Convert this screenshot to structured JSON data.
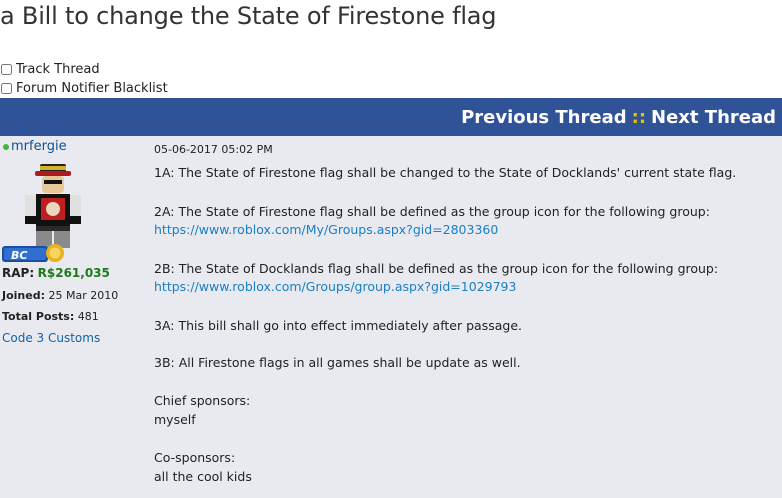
{
  "thread": {
    "title": "a Bill to change the State of Firestone flag"
  },
  "options": {
    "track_thread_label": "Track Thread",
    "blacklist_label": "Forum Notifier Blacklist"
  },
  "nav": {
    "previous_label": "Previous Thread",
    "separator": "::",
    "next_label": "Next Thread"
  },
  "author": {
    "username": "mrfergie",
    "badge_text": "BC",
    "rap_label": "RAP:",
    "rap_value": "R$261,035",
    "joined_label": "Joined:",
    "joined_value": "25 Mar 2010",
    "posts_label": "Total Posts:",
    "posts_value": "481",
    "group": "Code 3 Customs"
  },
  "post": {
    "date": "05-06-2017 05:02 PM",
    "lines": [
      "1A: The State of Firestone flag shall be changed to the State of Docklands' current state flag.",
      "2A: The State of Firestone flag shall be defined as the group icon for the following group:",
      "https://www.roblox.com/My/Groups.aspx?gid=2803360",
      "2B: The State of Docklands flag shall be defined as the group icon for the following group:",
      "https://www.roblox.com/Groups/group.aspx?gid=1029793",
      "3A: This bill shall go into effect immediately after passage.",
      "3B: All Firestone flags in all games shall be update as well.",
      "Chief sponsors:",
      "myself",
      "Co-sponsors:",
      "all the cool kids"
    ]
  },
  "colors": {
    "nav_bar": "#2f5396",
    "separator": "#e9c300",
    "post_background": "#e8eaef",
    "link": "#1a7fc4",
    "rap_value": "#1c7a1c",
    "online": "#3fb63f"
  }
}
